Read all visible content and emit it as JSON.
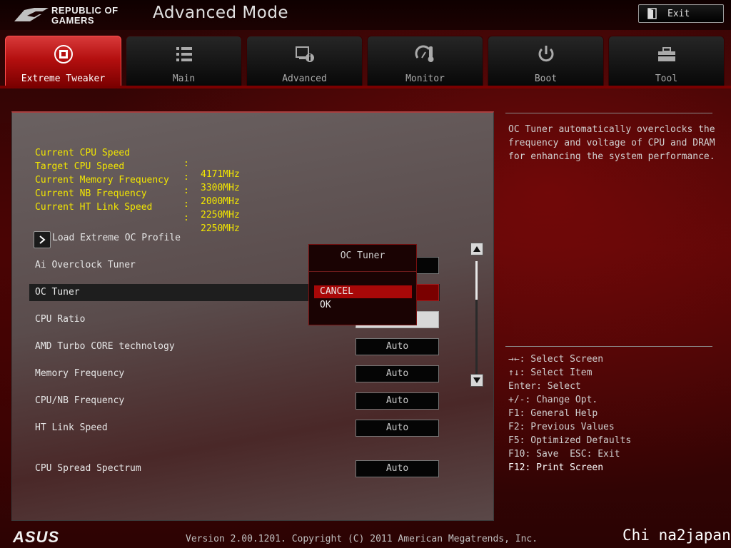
{
  "brand": {
    "logo_line1": "REPUBLIC OF",
    "logo_line2": "GAMERS"
  },
  "header": {
    "mode_title": "Advanced Mode",
    "exit_label": "Exit"
  },
  "tabs": [
    {
      "label": "Extreme Tweaker",
      "icon": "cpu-chip-icon",
      "active": true
    },
    {
      "label": "Main",
      "icon": "list-icon"
    },
    {
      "label": "Advanced",
      "icon": "monitor-info-icon"
    },
    {
      "label": "Monitor",
      "icon": "gauge-thermometer-icon"
    },
    {
      "label": "Boot",
      "icon": "power-icon"
    },
    {
      "label": "Tool",
      "icon": "toolbox-icon"
    }
  ],
  "info": [
    {
      "label": "Current CPU Speed",
      "value": "4171MHz"
    },
    {
      "label": "Target CPU Speed",
      "value": "3300MHz"
    },
    {
      "label": "Current Memory Frequency",
      "value": "2000MHz"
    },
    {
      "label": "Current NB Frequency",
      "value": "2250MHz"
    },
    {
      "label": "Current HT Link Speed",
      "value": "2250MHz"
    }
  ],
  "colon": ":",
  "settings": {
    "load_profile": "Load Extreme OC Profile",
    "ai_overclock": "Ai Overclock Tuner",
    "oc_tuner": "OC Tuner",
    "cpu_ratio": "CPU Ratio",
    "amd_turbo": {
      "label": "AMD Turbo CORE technology",
      "value": "Auto"
    },
    "memory_freq": {
      "label": "Memory Frequency",
      "value": "Auto"
    },
    "cpu_nb_freq": {
      "label": "CPU/NB Frequency",
      "value": "Auto"
    },
    "ht_link": {
      "label": "HT Link Speed",
      "value": "Auto"
    },
    "spread": {
      "label": "CPU Spread Spectrum",
      "value": "Auto"
    }
  },
  "dialog": {
    "title": "OC Tuner",
    "options": [
      "CANCEL",
      "OK"
    ],
    "selected": "CANCEL"
  },
  "description": "OC Tuner automatically overclocks the frequency and voltage of CPU and DRAM for enhancing the system performance.",
  "help": [
    "→←: Select Screen",
    "↑↓: Select Item",
    "Enter: Select",
    "+/-: Change Opt.",
    "F1: General Help",
    "F2: Previous Values",
    "F5: Optimized Defaults",
    "F10: Save  ESC: Exit",
    "F12: Print Screen"
  ],
  "footer": {
    "brand": "ASUS",
    "version": "Version 2.00.1201. Copyright (C) 2011 American Megatrends, Inc.",
    "watermark": "Chi na2japan"
  },
  "colors": {
    "accent": "#b40f0f",
    "info_text": "#f2e600",
    "selection": "#a80808"
  }
}
